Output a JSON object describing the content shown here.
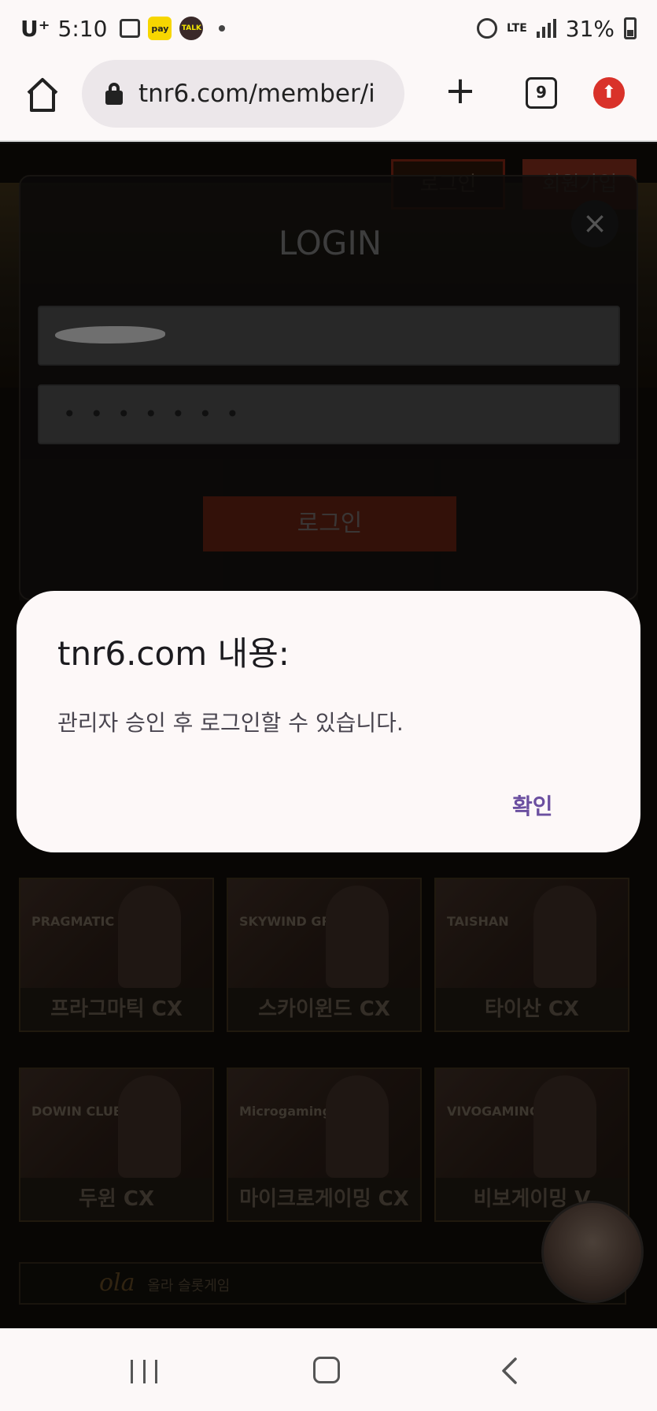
{
  "status_bar": {
    "carrier": "U⁺",
    "time": "5:10",
    "notifications": [
      "photo-icon",
      "kakaopay-icon",
      "kakaotalk-icon",
      "dot-icon"
    ],
    "network": "LTE",
    "battery": "31%"
  },
  "browser": {
    "url": "tnr6.com/member/i",
    "tab_count": "9"
  },
  "site": {
    "header_login": "로그인",
    "header_join": "회원가입",
    "login_modal": {
      "title": "LOGIN",
      "password_mask": "•••••••",
      "submit_label": "로그인",
      "close_symbol": "×"
    },
    "games_row1": [
      "프라그마틱 CX",
      "스카이윈드 CX",
      "타이산 CX"
    ],
    "games_row1_brands": [
      "PRAGMATIC PLAY",
      "SKYWIND GROUP",
      "TAISHAN"
    ],
    "games_row2": [
      "두윈 CX",
      "마이크로게이밍 CX",
      "비보게이밍 V"
    ],
    "games_row2_brands": [
      "DOWIN CLUB",
      "Microgaming",
      "VIVOGAMING"
    ],
    "slot_banner_logo": "ola",
    "slot_banner_text": "올라 슬롯게임"
  },
  "alert": {
    "title": "tnr6.com 내용:",
    "message": "관리자 승인 후 로그인할 수 있습니다.",
    "ok_label": "확인"
  },
  "colors": {
    "alert_accent": "#6b4fa0",
    "update_badge": "#d9322a",
    "site_login_button": "#5e1f12"
  }
}
